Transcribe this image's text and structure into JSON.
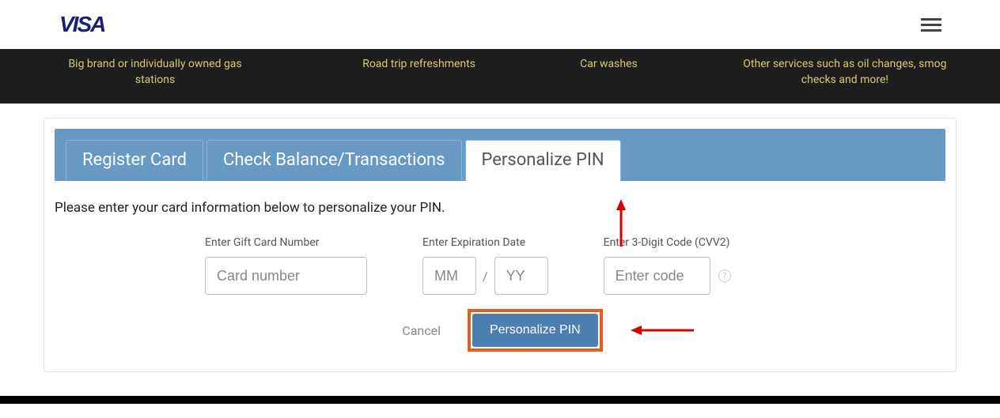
{
  "header": {
    "logo_text": "VISA"
  },
  "strip": {
    "col1": "Big brand or individually owned gas stations",
    "col2": "Road trip refreshments",
    "col3": "Car washes",
    "col4": "Other services such as oil changes, smog checks and more!"
  },
  "tabs": {
    "register": "Register Card",
    "balance": "Check Balance/Transactions",
    "pin": "Personalize PIN"
  },
  "form": {
    "instruction": "Please enter your card information below to personalize your PIN.",
    "card_label": "Enter Gift Card Number",
    "card_placeholder": "Card number",
    "exp_label": "Enter Expiration Date",
    "mm_placeholder": "MM",
    "yy_placeholder": "YY",
    "slash": "/",
    "cvv_label": "Enter 3-Digit Code (CVV2)",
    "cvv_placeholder": "Enter code",
    "help": "?",
    "cancel": "Cancel",
    "submit": "Personalize PIN"
  }
}
